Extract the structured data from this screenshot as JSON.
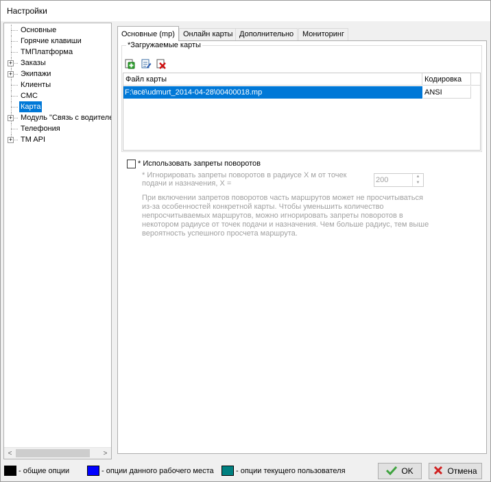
{
  "window": {
    "title": "Настройки"
  },
  "tree": {
    "items": [
      {
        "label": "Основные",
        "expandable": false
      },
      {
        "label": "Горячие клавиши",
        "expandable": false
      },
      {
        "label": "ТМПлатформа",
        "expandable": false
      },
      {
        "label": "Заказы",
        "expandable": true
      },
      {
        "label": "Экипажи",
        "expandable": true
      },
      {
        "label": "Клиенты",
        "expandable": false
      },
      {
        "label": "СМС",
        "expandable": false
      },
      {
        "label": "Карта",
        "expandable": false,
        "selected": true
      },
      {
        "label": "Модуль \"Связь с водителем\"",
        "expandable": true
      },
      {
        "label": "Телефония",
        "expandable": false
      },
      {
        "label": "TM API",
        "expandable": true
      }
    ],
    "expander_symbol": "+",
    "scroll_left": "<",
    "scroll_right": ">"
  },
  "tabs": [
    {
      "label": "Основные (mp)",
      "active": true
    },
    {
      "label": "Онлайн карты"
    },
    {
      "label": "Дополнительно"
    },
    {
      "label": "Мониторинг"
    }
  ],
  "maps_group": {
    "title": "*Загружаемые карты",
    "toolbar": {
      "add_icon": "add-map-icon",
      "edit_icon": "edit-map-icon",
      "delete_icon": "delete-map-icon"
    },
    "columns": [
      "Файл карты",
      "Кодировка"
    ],
    "rows": [
      {
        "file": "F:\\всё\\udmurt_2014-04-28\\00400018.mp",
        "encoding": "ANSI"
      }
    ]
  },
  "turn_restrictions": {
    "checkbox_label": "* Использовать запреты поворотов",
    "checked": false,
    "radius_label_line1": "* Игнорировать запреты поворотов в радиусе X м от точек",
    "radius_label_line2": "подачи  и назначения, X =",
    "radius_value": "200",
    "description_lines": [
      "При включении запретов поворотов часть маршрутов может не просчитываться",
      "из-за особенностей конкретной карты. Чтобы уменьшить количество",
      "непросчитываемых маршрутов, можно игнорировать запреты поворотов в",
      "некотором радиусе от точек подачи и назначения. Чем больше радиус, тем выше",
      "вероятность успешного просчета маршрута."
    ]
  },
  "legend": [
    {
      "color": "#000000",
      "text": "- общие опции"
    },
    {
      "color": "#0000ff",
      "text": "- опции данного рабочего места"
    },
    {
      "color": "#008080",
      "text": "- опции текущего пользователя"
    }
  ],
  "buttons": {
    "ok": {
      "label": "OK",
      "icon": "checkmark-icon"
    },
    "cancel": {
      "label": "Отмена",
      "icon": "cross-icon"
    }
  }
}
